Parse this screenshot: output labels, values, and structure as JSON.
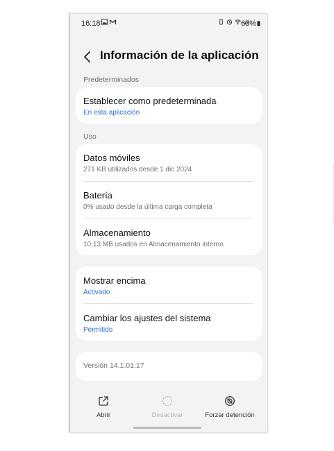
{
  "status_bar": {
    "time": "16:18",
    "battery": "63%",
    "left_icons": [
      "image-icon",
      "gmail-icon"
    ],
    "right_icons": [
      "vibrate-icon",
      "alarm-icon",
      "wifi-icon",
      "signal-icon",
      "battery-icon"
    ]
  },
  "header": {
    "title": "Información de la aplicación"
  },
  "sections": {
    "defaults_label": "Predeterminados",
    "usage_label": "Uso"
  },
  "defaults": {
    "title": "Establecer como predeterminada",
    "subtitle": "En esta aplicación"
  },
  "usage": {
    "mobile_data": {
      "title": "Datos móviles",
      "subtitle": "271 KB utilizados desde 1 dic 2024"
    },
    "battery": {
      "title": "Batería",
      "subtitle": "0% usado desde la última carga completa"
    },
    "storage": {
      "title": "Almacenamiento",
      "subtitle": "10,13 MB usados en Almacenamiento interno"
    }
  },
  "permissions": {
    "overlay": {
      "title": "Mostrar encima",
      "subtitle": "Activado"
    },
    "system_settings": {
      "title": "Cambiar los ajustes del sistema",
      "subtitle": "Permitido"
    }
  },
  "version": "Versión 14.1.01.17",
  "bottom_bar": {
    "open": "Abrir",
    "disable": "Desactivar",
    "force_stop": "Forzar detención"
  },
  "colors": {
    "accent_blue": "#2a6fd1",
    "background": "#f3f3f5",
    "card": "#ffffff"
  }
}
